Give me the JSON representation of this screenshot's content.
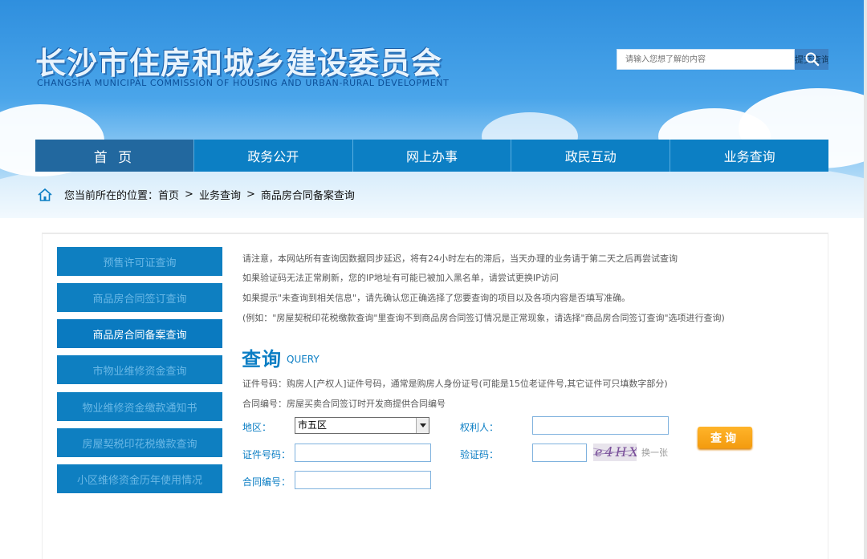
{
  "header": {
    "title": "长沙市住房和城乡建设委员会",
    "subtitle": "CHANGSHA MUNICIPAL COMMISSION OF HOUSING AND URBAN-RURAL DEVELOPMENT",
    "search_placeholder": "请输入您想了解的内容",
    "search_button": "提交查询"
  },
  "nav": [
    "首 页",
    "政务公开",
    "网上办事",
    "政民互动",
    "业务查询"
  ],
  "breadcrumb": {
    "prefix": "您当前所在的位置：",
    "items": [
      "首页",
      "业务查询",
      "商品房合同备案查询"
    ],
    "separator": ">"
  },
  "sidebar": [
    "预售许可证查询",
    "商品房合同签订查询",
    "商品房合同备案查询",
    "市物业维修资金查询",
    "物业维修资金缴款通知书",
    "房屋契税印花税缴款查询",
    "小区维修资金历年使用情况"
  ],
  "sidebar_active_index": 2,
  "notices": [
    "请注意，本网站所有查询因数据同步延迟，将有24小时左右的滞后，当天办理的业务请于第二天之后再尝试查询",
    "如果验证码无法正常刷新，您的IP地址有可能已被加入黑名单，请尝试更换IP访问",
    "如果提示\"未查询到相关信息\"，请先确认您正确选择了您要查询的项目以及各项内容是否填写准确。",
    "(例如：\"房屋契税印花税缴款查询\"里查询不到商品房合同签订情况是正常现象，请选择\"商品房合同签订查询\"选项进行查询)"
  ],
  "query": {
    "title": "查询",
    "title_en": "QUERY",
    "hints": [
      "证件号码：购房人[产权人]证件号码，通常是购房人身份证号(可能是15位老证件号,其它证件可只填数字部分)",
      "合同编号：房屋买卖合同签订时开发商提供合同编号"
    ]
  },
  "form": {
    "region_label": "地区：",
    "region_value": "市五区",
    "owner_label": "权利人：",
    "owner_value": "",
    "id_label": "证件号码：",
    "id_value": "",
    "captcha_label": "验证码：",
    "captcha_value": "",
    "captcha_image_text": "e4HX",
    "refresh_label": "换一张",
    "contract_label": "合同编号：",
    "contract_value": "",
    "submit_label": "查询"
  },
  "colors": {
    "accent": "#0b7ec4",
    "nav_bg": "#0c7fc4",
    "nav_active": "#22689f",
    "submit": "#f5a21a"
  }
}
